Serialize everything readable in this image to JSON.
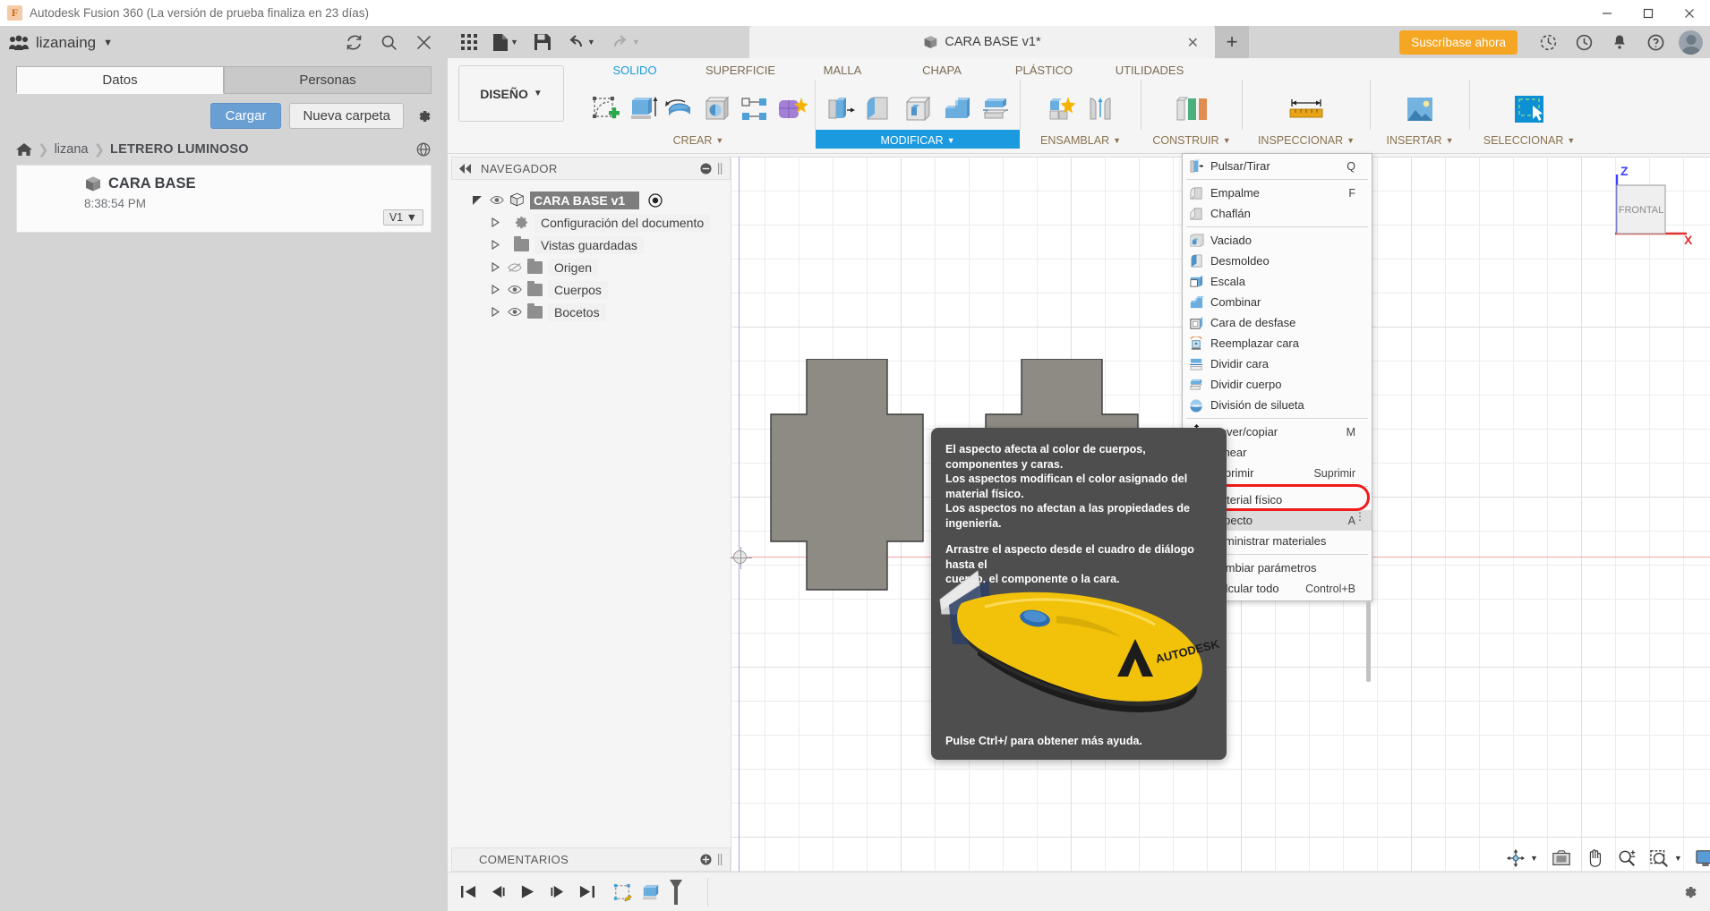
{
  "window": {
    "title": "Autodesk Fusion 360 (La versión de prueba finaliza en 23 días)",
    "logo_letter": "F",
    "minimize_icon": "minimize-icon",
    "maximize_icon": "maximize-icon",
    "close_icon": "close-icon"
  },
  "data_panel": {
    "team_name": "lizanaing",
    "team_caret": "▼",
    "refresh_icon": "refresh-icon",
    "search_icon": "search-icon",
    "close_icon": "close-icon",
    "tabs": [
      {
        "label": "Datos",
        "active": true
      },
      {
        "label": "Personas",
        "active": false
      }
    ],
    "upload_button": "Cargar",
    "new_folder_button": "Nueva carpeta",
    "settings_icon": "gear-icon",
    "breadcrumb": {
      "home_icon": "home-icon",
      "items": [
        "lizana",
        "LETRERO LUMINOSO"
      ],
      "separator": "❯",
      "globe_icon": "globe-icon"
    },
    "files": [
      {
        "name": "CARA BASE",
        "time": "8:38:54 PM",
        "version": "V1",
        "version_caret": "▼",
        "icon": "cube-icon"
      }
    ]
  },
  "quick_access": {
    "grid_icon": "app-grid-icon",
    "file_icon": "file-icon",
    "save_icon": "save-icon",
    "undo_icon": "undo-icon",
    "redo_icon": "redo-icon",
    "caret": "▼",
    "document_tab": {
      "label": "CARA BASE v1*",
      "icon": "cube-icon",
      "close": "✕"
    },
    "new_tab": "+",
    "subscribe_button": "Suscríbase ahora",
    "right_icons": [
      "job-status-icon",
      "recent-icon",
      "notifications-bell-icon",
      "help-question-icon"
    ],
    "avatar": "user-avatar"
  },
  "ribbon": {
    "workspace_label": "DISEÑO",
    "workspace_caret": "▼",
    "tabs": [
      {
        "label": "SOLIDO",
        "active": true
      },
      {
        "label": "SUPERFICIE",
        "active": false
      },
      {
        "label": "MALLA",
        "active": false
      },
      {
        "label": "CHAPA",
        "active": false
      },
      {
        "label": "PLÁSTICO",
        "active": false
      },
      {
        "label": "UTILIDADES",
        "active": false
      }
    ],
    "panels": [
      {
        "title": "CREAR",
        "caret": "▼",
        "highlighted": false,
        "icons": [
          "create-sketch-icon",
          "extrude-icon",
          "revolve-icon",
          "sweep-icon",
          "pattern-icon",
          "form-icon"
        ]
      },
      {
        "title": "MODIFICAR",
        "caret": "▼",
        "highlighted": true,
        "icons": [
          "press-pull-icon",
          "fillet-icon",
          "shell-icon",
          "combine-icon",
          "split-body-icon"
        ]
      },
      {
        "title": "ENSAMBLAR",
        "caret": "▼",
        "highlighted": false,
        "icons": [
          "new-component-icon",
          "joint-icon"
        ]
      },
      {
        "title": "CONSTRUIR",
        "caret": "▼",
        "highlighted": false,
        "icons": [
          "offset-plane-icon"
        ]
      },
      {
        "title": "INSPECCIONAR",
        "caret": "▼",
        "highlighted": false,
        "icons": [
          "measure-icon"
        ]
      },
      {
        "title": "INSERTAR",
        "caret": "▼",
        "highlighted": false,
        "icons": [
          "insert-image-icon"
        ]
      },
      {
        "title": "SELECCIONAR",
        "caret": "▼",
        "highlighted": false,
        "icons": [
          "window-selection-icon"
        ]
      }
    ]
  },
  "browser": {
    "title": "NAVEGADOR",
    "collapse_icon": "collapse-left-icon",
    "minus_icon": "minus-circle-icon",
    "grip_icon": "grip-icon",
    "tree": [
      {
        "label": "CARA BASE v1",
        "level": 0,
        "arrow": "◢",
        "eye": "eye-visible-icon",
        "icon": "cube-icon",
        "radio": "activate-component-icon",
        "selected": true
      },
      {
        "label": "Configuración del documento",
        "level": 1,
        "arrow": "▷",
        "icon": "gear-icon",
        "eye": ""
      },
      {
        "label": "Vistas guardadas",
        "level": 1,
        "arrow": "▷",
        "icon": "folder-icon",
        "eye": ""
      },
      {
        "label": "Origen",
        "level": 2,
        "arrow": "▷",
        "icon": "folder-icon",
        "eye": "eye-hidden-icon"
      },
      {
        "label": "Cuerpos",
        "level": 2,
        "arrow": "▷",
        "icon": "folder-icon",
        "eye": "eye-visible-icon"
      },
      {
        "label": "Bocetos",
        "level": 2,
        "arrow": "▷",
        "icon": "folder-icon",
        "eye": "eye-visible-icon"
      }
    ]
  },
  "modificar_menu": {
    "items": [
      {
        "label": "Pulsar/Tirar",
        "shortcut": "Q",
        "icon": "press-pull-icon"
      },
      {
        "separator": true
      },
      {
        "label": "Empalme",
        "shortcut": "F",
        "icon": "fillet-icon"
      },
      {
        "label": "Chaflán",
        "shortcut": "",
        "icon": "chamfer-icon"
      },
      {
        "separator": true
      },
      {
        "label": "Vaciado",
        "shortcut": "",
        "icon": "shell-icon"
      },
      {
        "label": "Desmoldeo",
        "shortcut": "",
        "icon": "draft-icon"
      },
      {
        "label": "Escala",
        "shortcut": "",
        "icon": "scale-icon"
      },
      {
        "label": "Combinar",
        "shortcut": "",
        "icon": "combine-icon"
      },
      {
        "label": "Cara de desfase",
        "shortcut": "",
        "icon": "offset-face-icon"
      },
      {
        "label": "Reemplazar cara",
        "shortcut": "",
        "icon": "replace-face-icon"
      },
      {
        "label": "Dividir cara",
        "shortcut": "",
        "icon": "split-face-icon"
      },
      {
        "label": "Dividir cuerpo",
        "shortcut": "",
        "icon": "split-body-icon"
      },
      {
        "label": "División de silueta",
        "shortcut": "",
        "icon": "silhouette-split-icon"
      },
      {
        "separator": true
      },
      {
        "label": "Mover/copiar",
        "shortcut": "M",
        "icon": "move-copy-icon"
      },
      {
        "label": "Alinear",
        "shortcut": "",
        "icon": "align-icon"
      },
      {
        "label": "Suprimir",
        "shortcut": "Suprimir",
        "icon": "delete-icon"
      },
      {
        "separator": true
      },
      {
        "label": "Material físico",
        "shortcut": "",
        "icon": "physical-material-icon"
      },
      {
        "label": "Aspecto",
        "shortcut": "A",
        "icon": "appearance-icon",
        "highlighted": true,
        "overflow": "⋮"
      },
      {
        "label": "Administrar materiales",
        "shortcut": "",
        "icon": "manage-materials-icon"
      },
      {
        "separator": true
      },
      {
        "label": "Cambiar parámetros",
        "shortcut": "",
        "icon": "change-parameters-icon"
      },
      {
        "label": "Calcular todo",
        "shortcut": "Control+B",
        "icon": "compute-all-icon"
      }
    ],
    "highlight_ring_color": "#f01b1b"
  },
  "tooltip": {
    "paragraphs": [
      "El aspecto afecta al color de cuerpos, componentes y caras. Los aspectos modifican el color asignado del material físico. Los aspectos no afectan a las propiedades de ingeniería.",
      "Arrastre el aspecto desde el cuadro de diálogo hasta el cuerpo, el componente o la cara."
    ],
    "lines": [
      "El aspecto afecta al color de cuerpos, componentes y caras.",
      "Los aspectos modifican el color asignado del material físico.",
      "Los aspectos no afectan a las propiedades de ingeniería.",
      "Arrastre el aspecto desde el cuadro de diálogo hasta el",
      "cuerpo, el componente o la cara."
    ],
    "footer": "Pulse Ctrl+/ para obtener más ayuda.",
    "image_label": "AUTODESK",
    "image_alt": "utility-knife-illustration",
    "background_color": "#4e4e4e"
  },
  "viewport": {
    "viewcube_face": "FRONTAL",
    "axis_z": "Z",
    "axis_x": "X",
    "axis_z_color": "#4040ff",
    "axis_x_color": "#e03030",
    "model_color": "#8e8b84"
  },
  "comments": {
    "title": "COMENTARIOS",
    "add_icon": "plus-circle-icon",
    "grip_icon": "grip-icon"
  },
  "nav_toolbar": {
    "icons": [
      "orbit-icon",
      "look-at-icon",
      "pan-icon",
      "zoom-icon",
      "zoom-window-icon",
      "display-settings-icon"
    ],
    "carets": [
      "▼",
      "▼"
    ]
  },
  "timeline": {
    "controls": [
      "go-to-beginning-icon",
      "step-back-icon",
      "play-icon",
      "step-forward-icon",
      "go-to-end-icon"
    ],
    "features": [
      "sketch-feature-icon",
      "extrude-feature-icon"
    ],
    "settings_icon": "gear-icon"
  }
}
